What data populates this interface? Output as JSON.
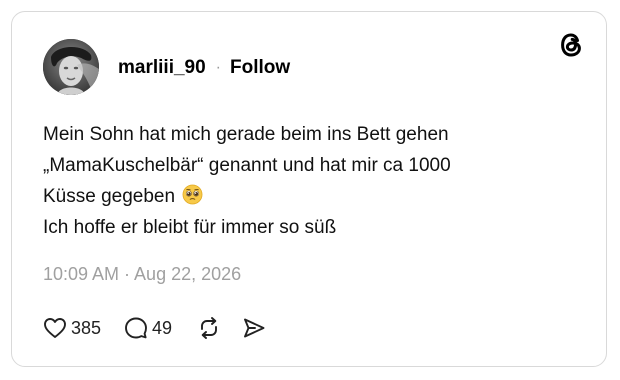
{
  "post": {
    "username": "marliii_90",
    "separator": "·",
    "follow_label": "Follow",
    "text_lines": [
      "Mein Sohn hat mich gerade beim ins Bett gehen",
      "„MamaKuschelbär“ genannt und hat mir ca 1000",
      "Küsse gegeben",
      "Ich hoffe er bleibt für immer so süß"
    ],
    "emoji": "pleading-face-emoji",
    "timestamp": "10:09 AM · Aug 22, 2026",
    "likes": "385",
    "replies": "49"
  },
  "icons": {
    "brand": "threads-logo-icon",
    "like": "heart-icon",
    "reply": "comment-icon",
    "repost": "repost-icon",
    "share": "send-icon"
  },
  "colors": {
    "text": "#000000",
    "muted": "#a0a0a0",
    "border": "#d9d9d9",
    "background": "#ffffff"
  }
}
